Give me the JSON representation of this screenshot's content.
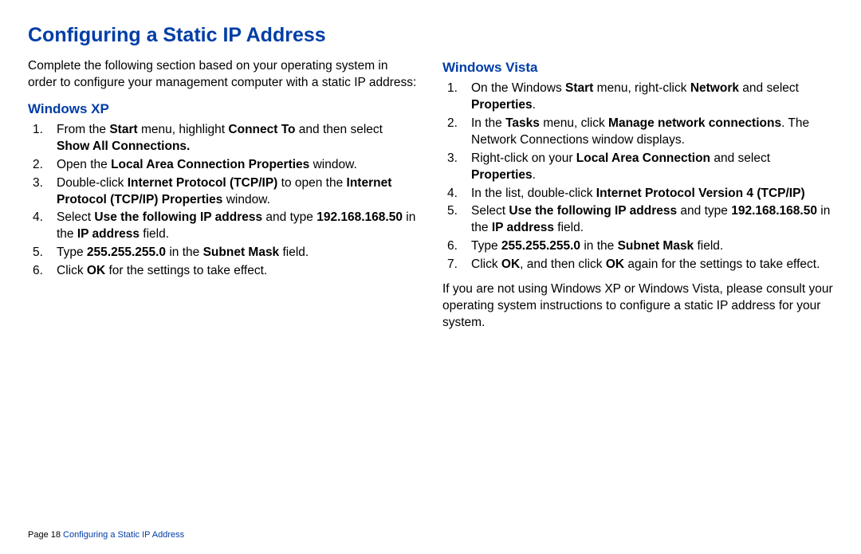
{
  "title": "Configuring a Static IP Address",
  "intro": "Complete the following section based on your operating system in order to configure your management computer with a static IP address:",
  "xp": {
    "heading": "Windows XP",
    "steps": [
      "From the <b>Start</b> menu, highlight <b>Connect To</b> and then select <b>Show All Connections.</b>",
      "Open the <b>Local Area Connection Properties</b> window.",
      "Double-click <b>Internet Protocol (TCP/IP)</b> to open the <b>Internet Protocol (TCP/IP) Properties</b> window.",
      "Select <b>Use the following IP address</b> and type <b>192.168.168.50</b> in the <b>IP address</b> field.",
      "Type <b>255.255.255.0</b> in the <b>Subnet Mask</b> field.",
      "Click <b>OK</b> for the settings to take effect."
    ]
  },
  "vista": {
    "heading": "Windows Vista",
    "steps": [
      "On the Windows <b>Start</b> menu, right-click <b>Network</b> and select <b>Properties</b>.",
      "In the <b>Tasks</b> menu, click <b>Manage network connections</b>. The Network Connections window displays.",
      "Right-click on your <b>Local Area Connection</b> and select <b>Properties</b>.",
      "In the list, double-click <b>Internet Protocol Version 4 (TCP/IP)</b>",
      "Select <b>Use the following IP address</b> and type <b>192.168.168.50</b> in the <b>IP address</b> field.",
      "Type <b>255.255.255.0</b> in the <b>Subnet Mask</b> field.",
      "Click <b>OK</b>, and then click <b>OK</b> again for the settings to take effect."
    ]
  },
  "note": "If you are not using Windows XP or Windows Vista, please consult your operating system instructions to configure a static IP address for your system.",
  "footer": {
    "page": "Page 18",
    "title": "Configuring a Static IP Address"
  }
}
